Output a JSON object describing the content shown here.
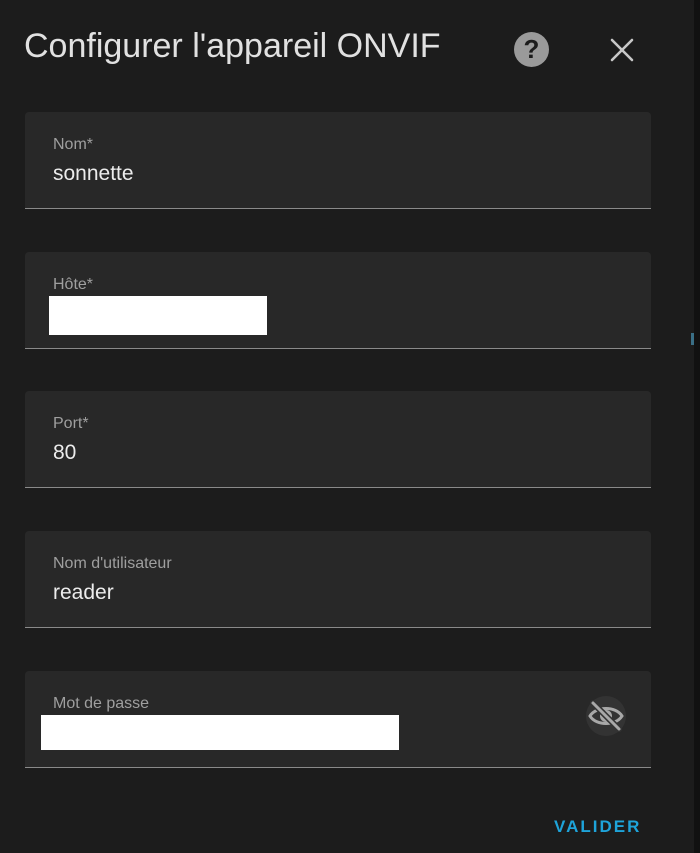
{
  "dialog": {
    "title": "Configurer l'appareil ONVIF",
    "help_icon": "help-circle-icon",
    "close_icon": "close-icon"
  },
  "fields": {
    "name": {
      "label": "Nom*",
      "value": "sonnette"
    },
    "host": {
      "label": "Hôte*",
      "value": ""
    },
    "port": {
      "label": "Port*",
      "value": "80"
    },
    "username": {
      "label": "Nom d'utilisateur",
      "value": "reader"
    },
    "password": {
      "label": "Mot de passe",
      "value": "",
      "toggle_icon": "eye-off-icon"
    }
  },
  "actions": {
    "submit_label": "VALIDER"
  },
  "colors": {
    "background": "#1c1c1c",
    "field_background": "#282828",
    "accent": "#1ea3d9",
    "label": "#9f9f9f",
    "text": "#ececec"
  }
}
